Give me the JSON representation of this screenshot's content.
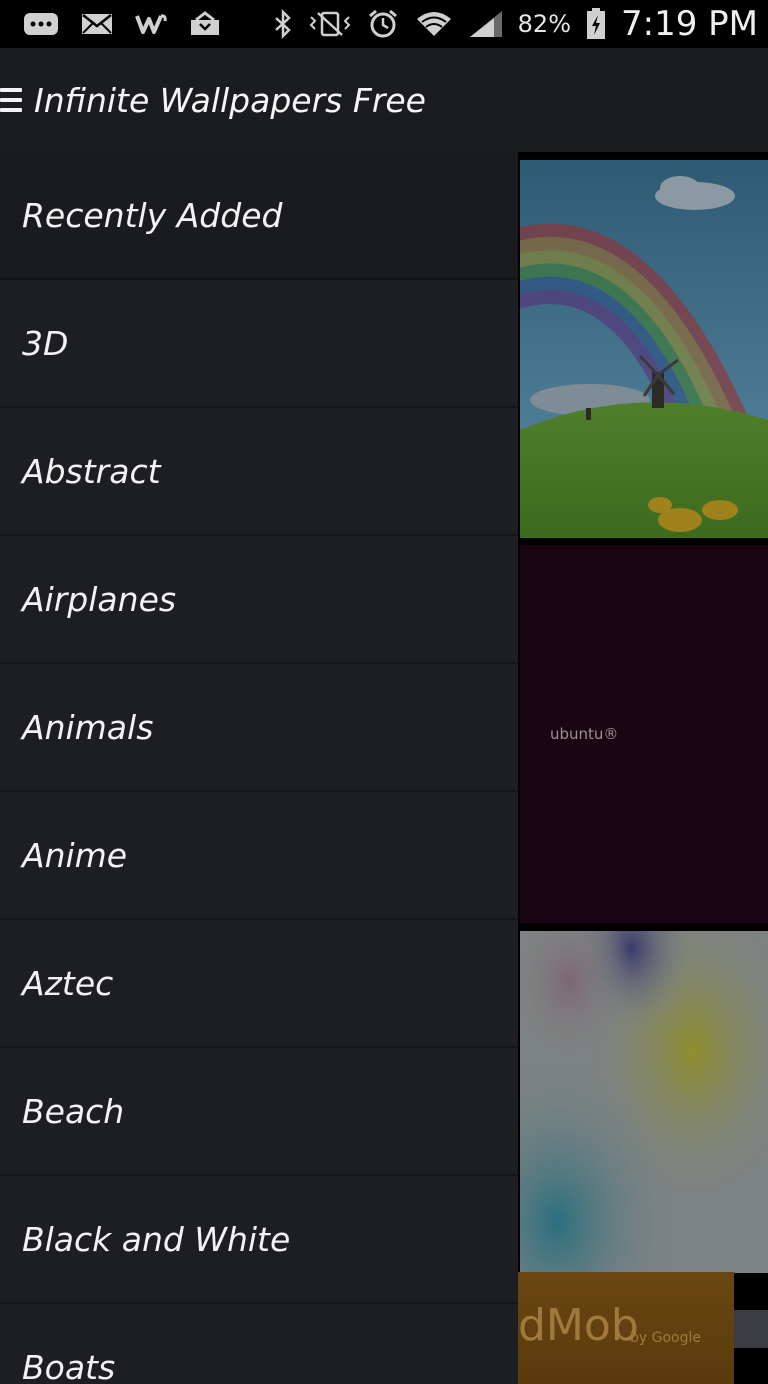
{
  "status_bar": {
    "battery": "82%",
    "time": "7:19 PM",
    "icons": [
      "messages-icon",
      "email-icon",
      "w-app-icon",
      "inbox-icon",
      "bluetooth-icon",
      "vibrate-icon",
      "alarm-icon",
      "wifi-icon",
      "signal-icon",
      "battery-icon"
    ]
  },
  "action_bar": {
    "title": "Infinite Wallpapers Free",
    "menu_icon": "hamburger-icon"
  },
  "drawer": {
    "items": [
      {
        "label": "Recently Added",
        "selected": true
      },
      {
        "label": "3D"
      },
      {
        "label": "Abstract"
      },
      {
        "label": "Airplanes"
      },
      {
        "label": "Animals"
      },
      {
        "label": "Anime"
      },
      {
        "label": "Aztec"
      },
      {
        "label": "Beach"
      },
      {
        "label": "Black and White"
      },
      {
        "label": "Boats"
      }
    ]
  },
  "content": {
    "ubuntu_label": "ubuntu®",
    "ad_text": "dMob",
    "ad_sub": "by Google"
  },
  "colors": {
    "background": "#000000",
    "action_bar": "#1b1c1f",
    "drawer": "#1d1e21",
    "divider": "#141517",
    "text": "#f2f2f2"
  }
}
